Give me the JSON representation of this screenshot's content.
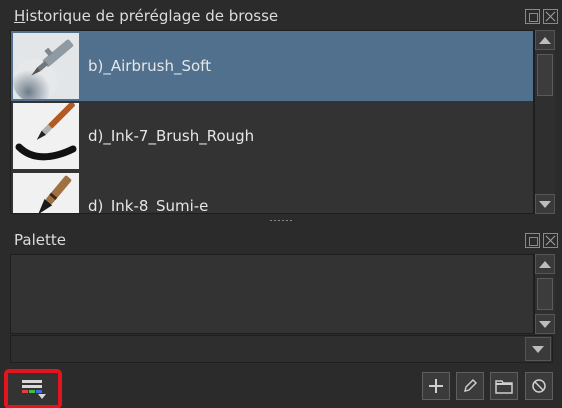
{
  "brush_history": {
    "title": "Historique de préréglage de brosse",
    "items": [
      {
        "label": "b)_Airbrush_Soft",
        "selected": true,
        "icon": "airbrush-icon"
      },
      {
        "label": "d)_Ink-7_Brush_Rough",
        "selected": false,
        "icon": "ink-brush-icon"
      },
      {
        "label": "d)_Ink-8_Sumi-e",
        "selected": false,
        "icon": "sumi-e-brush-icon"
      }
    ]
  },
  "palette": {
    "title": "Palette",
    "toolbar": {
      "menu_icon": "palette-menu-icon",
      "add_icon": "plus-icon",
      "edit_icon": "pencil-icon",
      "open_icon": "folder-icon",
      "clear_icon": "forbidden-icon"
    }
  },
  "colors": {
    "selected_row": "#50708e",
    "highlight": "#e4141e",
    "panel_bg": "#2b2b2b",
    "list_bg": "#333333"
  }
}
